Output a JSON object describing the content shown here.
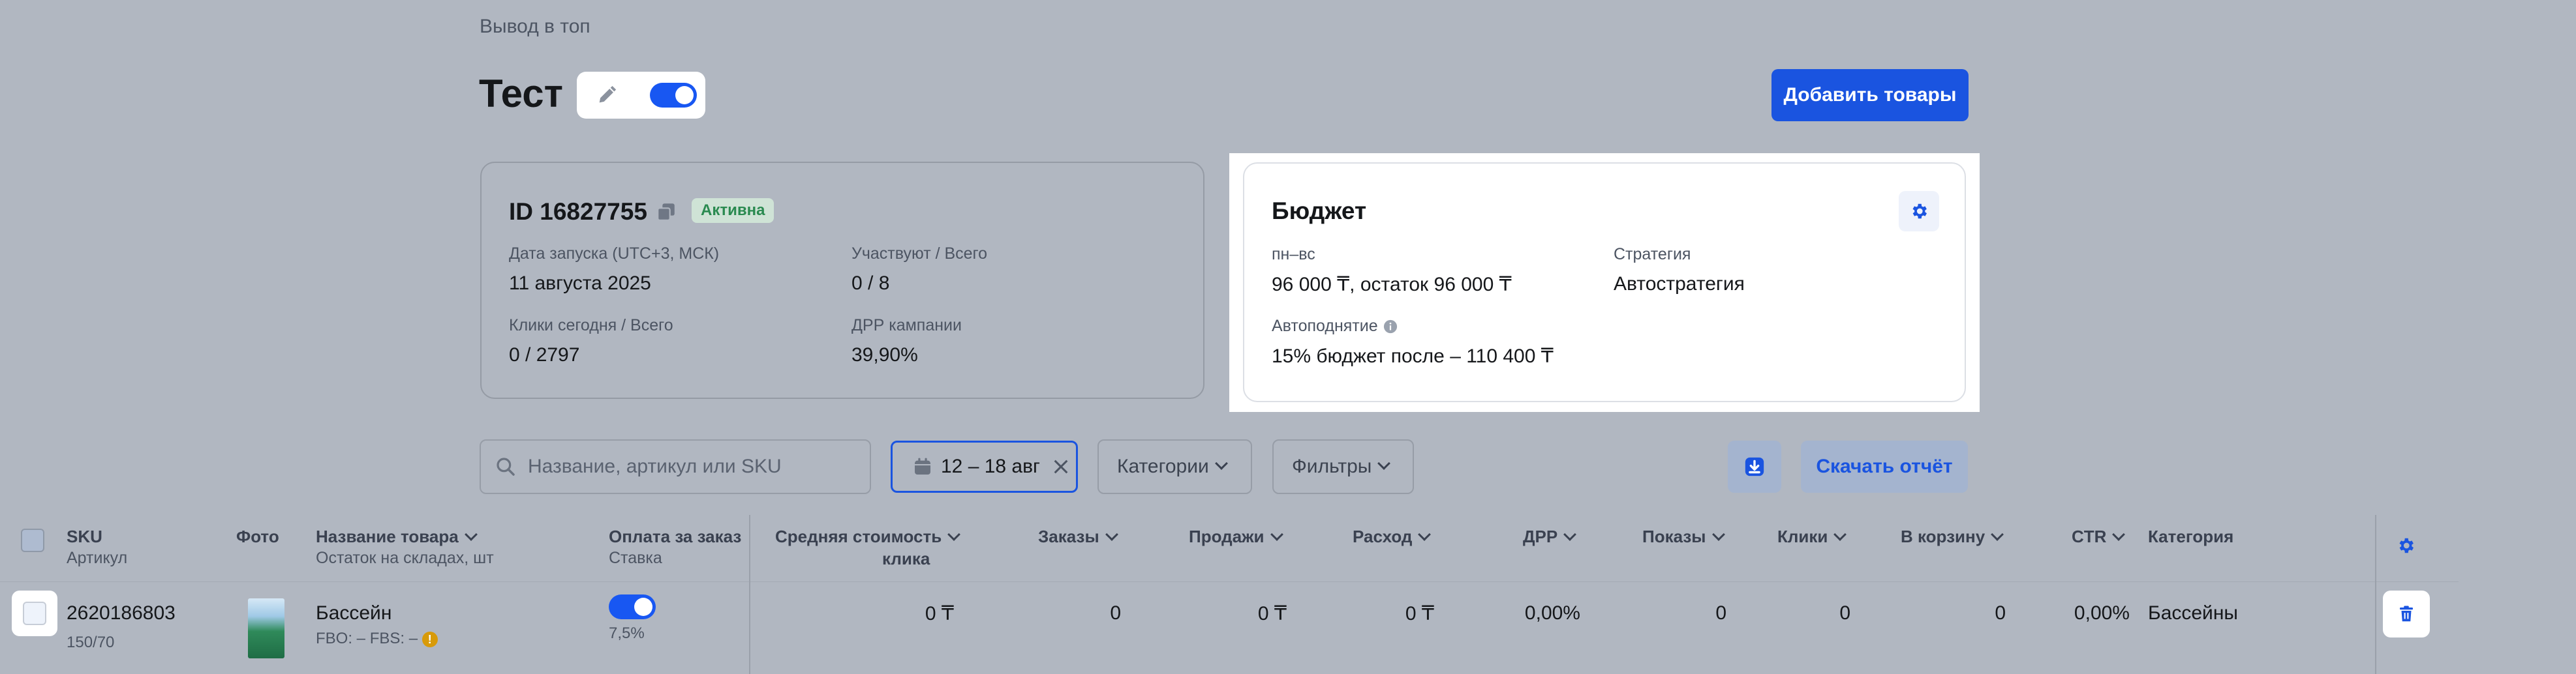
{
  "breadcrumb": "Вывод в топ",
  "page_title": "Тест",
  "add_products_label": "Добавить товары",
  "campaign": {
    "id_text": "ID 16827755",
    "status": "Активна",
    "launch_label": "Дата запуска (UTC+3, МСК)",
    "launch_value": "11 августа 2025",
    "participants_label": "Участвуют / Всего",
    "participants_value": "0 / 8",
    "clicks_label": "Клики сегодня / Всего",
    "clicks_value": "0 / 2797",
    "drr_label": "ДРР кампании",
    "drr_value": "39,90%"
  },
  "budget": {
    "title": "Бюджет",
    "period_label": "пн–вс",
    "period_value": "96 000 ₸, остаток 96 000 ₸",
    "strategy_label": "Стратегия",
    "strategy_value": "Автостратегия",
    "autoraise_label": "Автоподнятие",
    "autoraise_value": "15% бюджет после – 110 400 ₸"
  },
  "filters": {
    "search_placeholder": "Название, артикул или SKU",
    "date_range": "12 – 18 авг",
    "categories_label": "Категории",
    "filters_label": "Фильтры",
    "download_report_label": "Скачать отчёт"
  },
  "table": {
    "headers": {
      "sku": "SKU",
      "sku_sub": "Артикул",
      "photo": "Фото",
      "name": "Название товара",
      "name_sub": "Остаток на складах, шт",
      "payment": "Оплата за заказ",
      "payment_sub": "Ставка",
      "avg_cost_1": "Средняя стоимость",
      "avg_cost_2": "клика",
      "orders": "Заказы",
      "sales": "Продажи",
      "expense": "Расход",
      "drr": "ДРР",
      "impressions": "Показы",
      "clicks": "Клики",
      "to_cart": "В корзину",
      "ctr": "CTR",
      "category": "Категория"
    },
    "rows": [
      {
        "sku": "2620186803",
        "article": "150/70",
        "name": "Бассейн",
        "stock": "FBO: –   FBS: –",
        "rate": "7,5%",
        "avg_cost": "0 ₸",
        "orders": "0",
        "sales": "0 ₸",
        "expense": "0 ₸",
        "drr": "0,00%",
        "impressions": "0",
        "clicks": "0",
        "to_cart": "0",
        "ctr": "0,00%",
        "category": "Бассейны"
      }
    ]
  },
  "colors": {
    "accent": "#1a54e0",
    "background": "#b1b7c1",
    "active_badge_bg": "#cfe3d6",
    "active_badge_text": "#2a8a50",
    "warning": "#d89a09"
  },
  "icons": [
    "pencil-icon",
    "copy-icon",
    "gear-icon",
    "info-icon",
    "search-icon",
    "calendar-icon",
    "close-icon",
    "chevron-down-icon",
    "download-icon",
    "trash-icon"
  ]
}
